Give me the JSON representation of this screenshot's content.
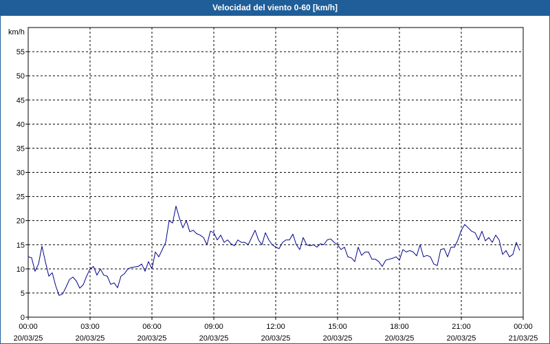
{
  "window": {
    "title": "Velocidad del viento 0-60 [km/h]"
  },
  "chart_data": {
    "type": "line",
    "title": "Velocidad del viento 0-60 [km/h]",
    "ylabel": "km/h",
    "xlabel": "",
    "ylim": [
      0,
      60
    ],
    "yticks": [
      0,
      5,
      10,
      15,
      20,
      25,
      30,
      35,
      40,
      45,
      50,
      55
    ],
    "xlim": [
      "2025-03-20T00:00",
      "2025-03-21T00:00"
    ],
    "xticks": [
      {
        "time": "00:00",
        "date": "20/03/25"
      },
      {
        "time": "03:00",
        "date": "20/03/25"
      },
      {
        "time": "06:00",
        "date": "20/03/25"
      },
      {
        "time": "09:00",
        "date": "20/03/25"
      },
      {
        "time": "12:00",
        "date": "20/03/25"
      },
      {
        "time": "15:00",
        "date": "20/03/25"
      },
      {
        "time": "18:00",
        "date": "20/03/25"
      },
      {
        "time": "21:00",
        "date": "20/03/25"
      },
      {
        "time": "00:00",
        "date": "21/03/25"
      }
    ],
    "grid": true,
    "line_color": "#00008b",
    "series": [
      {
        "x": [
          "00:00",
          "00:10",
          "00:20",
          "00:30",
          "00:40",
          "00:50",
          "01:00",
          "01:10",
          "01:20",
          "01:30",
          "01:40",
          "01:50",
          "02:00",
          "02:10",
          "02:20",
          "02:30",
          "02:40",
          "02:50",
          "03:00",
          "03:10",
          "03:20",
          "03:30",
          "03:40",
          "03:50",
          "04:00",
          "04:10",
          "04:20",
          "04:30",
          "04:40",
          "04:50",
          "05:00",
          "05:10",
          "05:20",
          "05:30",
          "05:40",
          "05:50",
          "06:00",
          "06:10",
          "06:20",
          "06:30",
          "06:40",
          "06:50",
          "07:00",
          "07:10",
          "07:20",
          "07:30",
          "07:40",
          "07:50",
          "08:00",
          "08:10",
          "08:20",
          "08:30",
          "08:40",
          "08:50",
          "09:00",
          "09:10",
          "09:20",
          "09:30",
          "09:40",
          "09:50",
          "10:00",
          "10:10",
          "10:20",
          "10:30",
          "10:40",
          "10:50",
          "11:00",
          "11:10",
          "11:20",
          "11:30",
          "11:40",
          "11:50",
          "12:00",
          "12:10",
          "12:20",
          "12:30",
          "12:40",
          "12:50",
          "13:00",
          "13:10",
          "13:20",
          "13:30",
          "13:40",
          "13:50",
          "14:00",
          "14:10",
          "14:20",
          "14:30",
          "14:40",
          "14:50",
          "15:00",
          "15:10",
          "15:20",
          "15:30",
          "15:40",
          "15:50",
          "16:00",
          "16:10",
          "16:20",
          "16:30",
          "16:40",
          "16:50",
          "17:00",
          "17:10",
          "17:20",
          "17:30",
          "17:40",
          "17:50",
          "18:00",
          "18:10",
          "18:20",
          "18:30",
          "18:40",
          "18:50",
          "19:00",
          "19:10",
          "19:20",
          "19:30",
          "19:40",
          "19:50",
          "20:00",
          "20:10",
          "20:20",
          "20:30",
          "20:40",
          "20:50",
          "21:00",
          "21:10",
          "21:20",
          "21:30",
          "21:40",
          "21:50",
          "22:00",
          "22:10",
          "22:20",
          "22:30",
          "22:40",
          "22:50",
          "23:00",
          "23:10",
          "23:20",
          "23:30",
          "23:40",
          "23:50"
        ],
        "values": [
          12.5,
          12.3,
          9.5,
          11.0,
          14.7,
          11.5,
          8.5,
          9.2,
          6.5,
          4.5,
          4.8,
          6.2,
          7.8,
          8.3,
          7.5,
          6.0,
          6.7,
          8.5,
          10.0,
          10.5,
          8.7,
          10.0,
          8.7,
          8.5,
          6.8,
          7.1,
          6.1,
          8.5,
          9.0,
          10.0,
          10.3,
          10.4,
          10.5,
          11.0,
          9.5,
          11.5,
          10.0,
          13.5,
          12.5,
          14.0,
          15.5,
          20.0,
          19.5,
          23.0,
          20.5,
          18.5,
          20.0,
          17.7,
          18.0,
          17.3,
          17.0,
          16.5,
          15.0,
          17.8,
          17.5,
          16.0,
          17.0,
          15.5,
          16.0,
          15.2,
          14.8,
          16.0,
          15.5,
          15.5,
          15.0,
          16.5,
          18.0,
          16.0,
          15.0,
          17.5,
          16.0,
          15.0,
          14.5,
          14.2,
          15.5,
          16.0,
          16.0,
          17.2,
          15.0,
          14.0,
          16.5,
          15.0,
          14.8,
          15.0,
          14.5,
          15.2,
          15.0,
          16.0,
          16.2,
          15.5,
          15.0,
          14.0,
          14.5,
          12.5,
          12.3,
          11.5,
          14.5,
          12.8,
          13.5,
          13.5,
          12.0,
          12.0,
          11.5,
          10.5,
          11.8,
          12.0,
          12.2,
          12.5,
          11.8,
          14.0,
          13.5,
          13.8,
          13.5,
          12.7,
          15.0,
          12.5,
          12.8,
          12.5,
          11.0,
          10.7,
          14.0,
          14.2,
          12.5,
          14.5,
          14.5,
          16.0,
          18.0,
          19.2,
          18.5,
          17.8,
          17.5,
          16.0,
          17.8,
          15.8,
          16.5,
          15.5,
          17.0,
          16.0,
          13.0,
          13.8,
          12.5,
          13.0,
          15.5,
          13.8
        ]
      }
    ]
  }
}
